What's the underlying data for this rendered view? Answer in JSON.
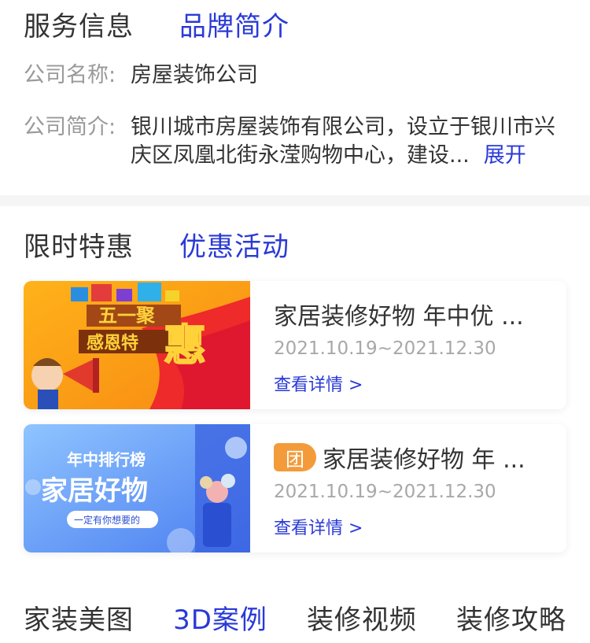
{
  "service": {
    "tabs": [
      "服务信息",
      "品牌简介"
    ],
    "company_name_label": "公司名称:",
    "company_name": "房屋装饰公司",
    "intro_label": "公司简介:",
    "intro_text": "银川城市房屋装饰有限公司，设立于银川市兴庆区凤凰北街永滢购物中心，建设...",
    "expand_label": "展开"
  },
  "promo": {
    "tabs": [
      "限时特惠",
      "优惠活动"
    ],
    "cards": [
      {
        "title": "家居装修好物 年中优 ...",
        "date": "2021.10.19~2021.12.30",
        "link": "查看详情 >",
        "image": {
          "line1": "五一聚",
          "line2": "感恩特",
          "big": "惠"
        }
      },
      {
        "badge": "团",
        "title": "家居装修好物 年 ...",
        "date": "2021.10.19~2021.12.30",
        "link": "查看详情 >",
        "image": {
          "line1": "年中排行榜",
          "line2": "家居好物",
          "pill": "一定有你想要的"
        }
      }
    ]
  },
  "bottom_tabs": [
    "家装美图",
    "3D案例",
    "装修视频",
    "装修攻略"
  ],
  "colors": {
    "accent": "#2a3ad6",
    "badge": "#f39b3a",
    "muted": "#999999"
  }
}
